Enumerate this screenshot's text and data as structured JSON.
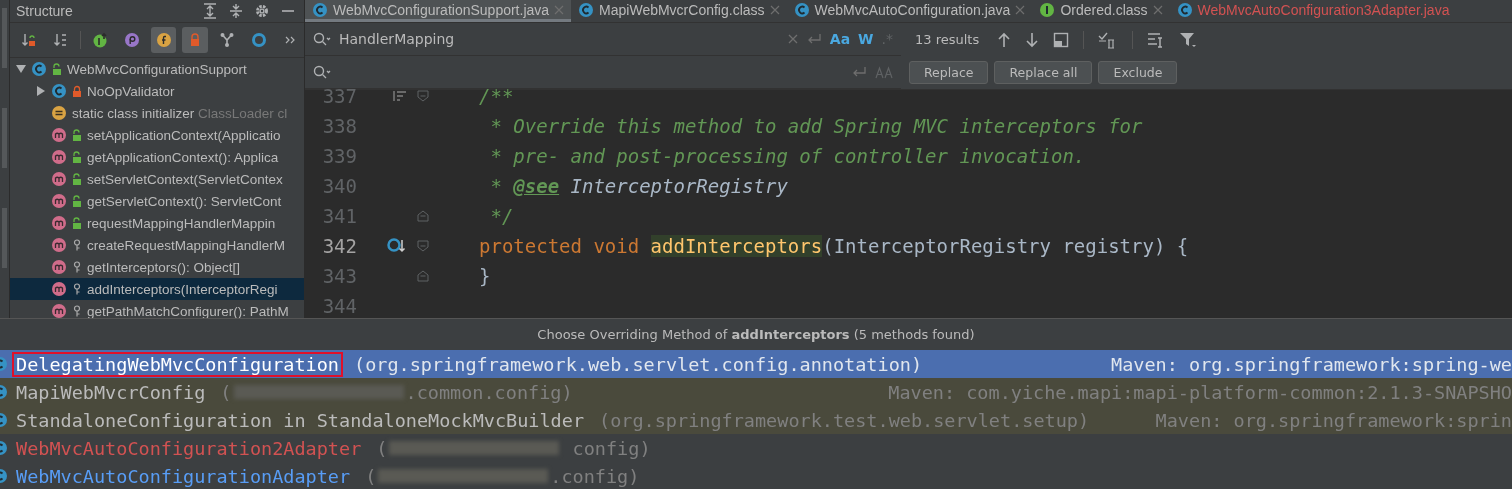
{
  "structure": {
    "title": "Structure",
    "toolbar": [
      {
        "kind": "sort-visibility",
        "on": false
      },
      {
        "kind": "sort-alpha",
        "on": false
      },
      {
        "kind": "inherited",
        "on": false
      },
      {
        "kind": "properties",
        "on": false
      },
      {
        "kind": "fields",
        "on": true
      },
      {
        "kind": "non-public",
        "on": true
      },
      {
        "kind": "hierarchy",
        "on": false
      },
      {
        "kind": "anonymous",
        "on": false
      },
      {
        "kind": "more",
        "on": false
      }
    ],
    "tree": [
      {
        "label": "WebMvcConfigurationSupport",
        "kind": "public-class",
        "expanded": true,
        "selected": false,
        "children": [
          {
            "label": "NoOpValidator",
            "kind": "private-class",
            "expanded": false,
            "selected": false
          },
          {
            "label": "static class initializer",
            "detail": "ClassLoader cl",
            "kind": "initializer",
            "selected": false
          },
          {
            "label": "setApplicationContext(Applicatio",
            "kind": "public-method",
            "selected": false
          },
          {
            "label": "getApplicationContext(): Applica",
            "kind": "public-method",
            "selected": false
          },
          {
            "label": "setServletContext(ServletContex",
            "kind": "public-method",
            "selected": false
          },
          {
            "label": "getServletContext(): ServletCont",
            "kind": "public-method",
            "selected": false
          },
          {
            "label": "requestMappingHandlerMappin",
            "kind": "public-method",
            "selected": false
          },
          {
            "label": "createRequestMappingHandlerM",
            "kind": "protected-method",
            "selected": false
          },
          {
            "label": "getInterceptors(): Object[]",
            "kind": "protected-method",
            "selected": false
          },
          {
            "label": "addInterceptors(InterceptorRegi",
            "kind": "protected-method",
            "selected": true
          },
          {
            "label": "getPathMatchConfigurer(): PathM",
            "kind": "protected-method",
            "selected": false
          }
        ]
      }
    ]
  },
  "editor": {
    "tabs": [
      {
        "label": "WebMvcConfigurationSupport.java",
        "kind": "class",
        "selected": true,
        "closable": true,
        "color": "#bbbbbb"
      },
      {
        "label": "MapiWebMvcrConfig.class",
        "kind": "class",
        "selected": false,
        "closable": true,
        "color": "#bbbbbb"
      },
      {
        "label": "WebMvcAutoConfiguration.java",
        "kind": "class",
        "selected": false,
        "closable": true,
        "color": "#bbbbbb"
      },
      {
        "label": "Ordered.class",
        "kind": "interface",
        "selected": false,
        "closable": true,
        "color": "#bbbbbb"
      },
      {
        "label": "WebMvcAutoConfiguration3Adapter.java",
        "kind": "class",
        "selected": false,
        "closable": false,
        "color": "#d25252"
      }
    ],
    "find": {
      "value": "HandlerMapping",
      "options": [
        {
          "label": "Aa",
          "on": true
        },
        {
          "label": "W",
          "on": true
        },
        {
          "label": ".*",
          "on": false
        }
      ],
      "results": "13 results"
    },
    "replace": {
      "buttons": [
        "Replace",
        "Replace all",
        "Exclude"
      ]
    },
    "lines": [
      {
        "number": "337",
        "current": false,
        "kind": "separator",
        "fold_open": true,
        "fold_close": false,
        "tokens": [
          {
            "kind": "comment",
            "text": "/**"
          }
        ]
      },
      {
        "number": "338",
        "current": false,
        "kind": "plain",
        "fold_open": false,
        "fold_close": false,
        "tokens": [
          {
            "kind": "comment",
            "text": " * Override this method to add Spring MVC interceptors for"
          }
        ]
      },
      {
        "number": "339",
        "current": false,
        "kind": "plain",
        "fold_open": false,
        "fold_close": false,
        "tokens": [
          {
            "kind": "comment",
            "text": " * pre- and post-processing of controller invocation."
          }
        ]
      },
      {
        "number": "340",
        "current": false,
        "kind": "plain",
        "fold_open": false,
        "fold_close": false,
        "tokens": [
          {
            "kind": "comment",
            "text": " * "
          },
          {
            "kind": "doctag",
            "text": "@see"
          },
          {
            "kind": "docref",
            "text": " InterceptorRegistry"
          }
        ]
      },
      {
        "number": "341",
        "current": false,
        "kind": "plain",
        "fold_open": false,
        "fold_close": true,
        "tokens": [
          {
            "kind": "comment",
            "text": " */"
          }
        ]
      },
      {
        "number": "342",
        "current": true,
        "kind": "overridden",
        "fold_open": true,
        "fold_close": false,
        "tokens": [
          {
            "kind": "keyword",
            "text": "protected void "
          },
          {
            "kind": "match",
            "text": "addInterceptors"
          },
          {
            "kind": "plain",
            "text": "(InterceptorRegistry registry) {"
          }
        ]
      },
      {
        "number": "343",
        "current": false,
        "kind": "plain",
        "fold_open": false,
        "fold_close": true,
        "tokens": [
          {
            "kind": "plain",
            "text": "}"
          }
        ]
      },
      {
        "number": "344",
        "current": false,
        "kind": "plain",
        "fold_open": false,
        "fold_close": false
      }
    ]
  },
  "popup": {
    "title": "Choose Overriding Method of **addInterceptors** (5 methods found)",
    "rows": [
      {
        "name": "DelegatingWebMvcConfiguration",
        "package_start": "(org.springframework.web.servlet.config.annotation)",
        "redacted": false,
        "location": "Maven: org.springframework:spring-we",
        "selected": true,
        "shaded": false,
        "outlined": true
      },
      {
        "name": "MapiWebMvcrConfig",
        "package_start": "(",
        "redacted": true,
        "package_end": ".common.config)",
        "location": "Maven: com.yiche.mapi:mapi-platform-common:2.1.3-SNAPSHO",
        "selected": false,
        "shaded": true,
        "outlined": false
      },
      {
        "name": "StandaloneConfiguration in StandaloneMockMvcBuilder",
        "package_start": "(org.springframework.test.web.servlet.setup)",
        "redacted": false,
        "location": "Maven: org.springframework:sprin",
        "selected": false,
        "shaded": true,
        "outlined": false
      },
      {
        "name": "WebMvcAutoConfiguration2Adapter",
        "package_start": "(",
        "redacted": true,
        "package_end": " config)",
        "selected": false,
        "shaded": false,
        "outlined": false,
        "color": "#d25252"
      },
      {
        "name": "WebMvcAutoConfigurationAdapter",
        "package_start": "(",
        "redacted": true,
        "package_end": ".config)",
        "selected": false,
        "shaded": false,
        "outlined": false,
        "color": "#589df6"
      }
    ]
  }
}
